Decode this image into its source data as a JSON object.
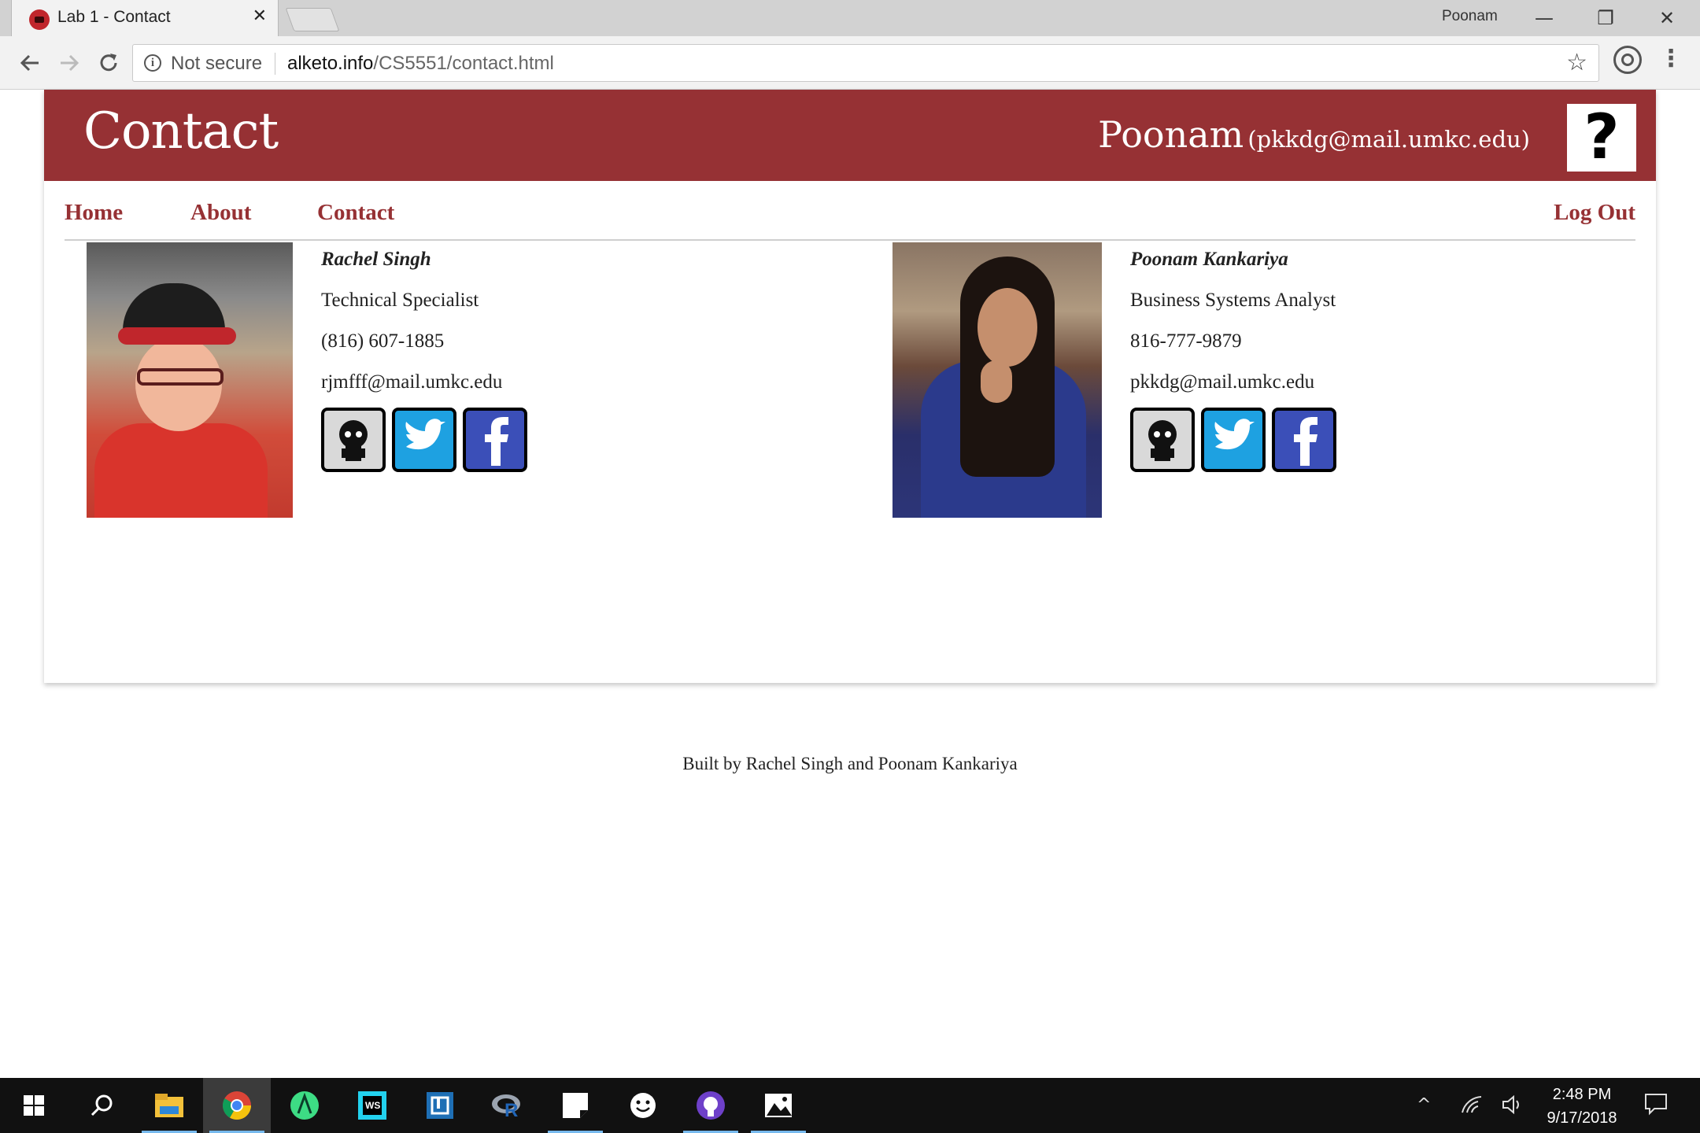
{
  "browser": {
    "tab_title": "Lab 1 - Contact",
    "tab_close": "✕",
    "profile_name": "Poonam",
    "security_label": "Not secure",
    "url_host": "alketo.info",
    "url_path": "/CS5551/contact.html",
    "window_min": "—",
    "window_max": "❐",
    "window_close": "✕"
  },
  "header": {
    "title": "Contact",
    "user_name": "Poonam",
    "user_email": "(pkkdg@mail.umkc.edu)",
    "help_symbol": "?"
  },
  "nav": {
    "home": "Home",
    "about": "About",
    "contact": "Contact",
    "logout": "Log Out"
  },
  "contacts": [
    {
      "name": "Rachel Singh",
      "title": "Technical Specialist",
      "phone": "(816) 607-1885",
      "email": "rjmfff@mail.umkc.edu",
      "socials": [
        "github-icon",
        "twitter-icon",
        "facebook-icon"
      ]
    },
    {
      "name": "Poonam Kankariya",
      "title": "Business Systems Analyst",
      "phone": "816-777-9879",
      "email": "pkkdg@mail.umkc.edu",
      "socials": [
        "github-icon",
        "twitter-icon",
        "facebook-icon"
      ]
    }
  ],
  "footer": {
    "text": "Built by Rachel Singh and Poonam Kankariya"
  },
  "taskbar": {
    "time": "2:48 PM",
    "date": "9/17/2018",
    "apps": [
      "start-icon",
      "search-icon",
      "file-explorer-icon",
      "chrome-icon",
      "android-studio-icon",
      "webstorm-icon",
      "app-icon",
      "r-icon",
      "sticky-notes-icon",
      "smiley-icon",
      "github-desktop-icon",
      "photos-icon"
    ]
  },
  "colors": {
    "brand": "#963134",
    "header_text": "#ffffff"
  }
}
